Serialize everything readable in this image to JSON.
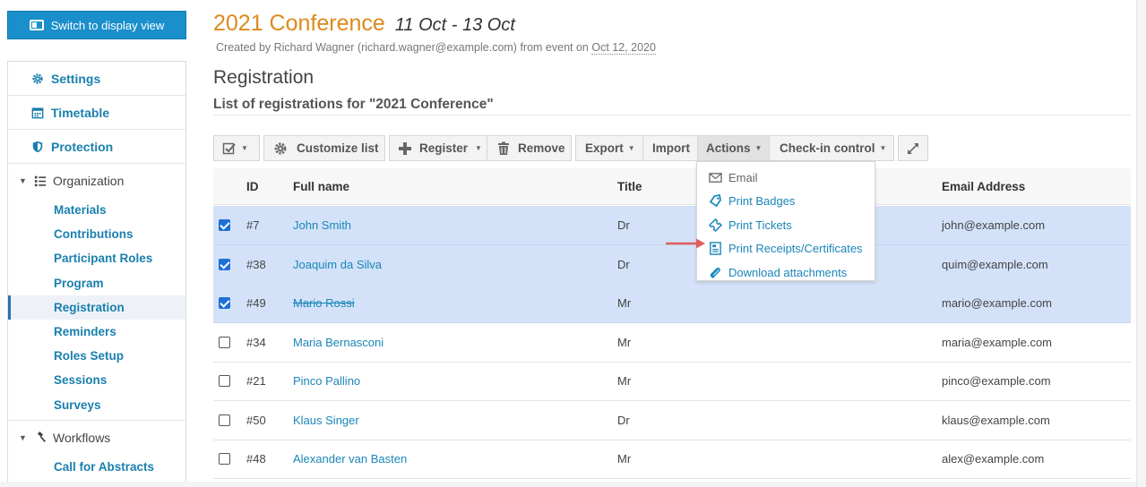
{
  "sidebar": {
    "switch_label": "Switch to display view",
    "items": [
      {
        "label": "Settings"
      },
      {
        "label": "Timetable"
      },
      {
        "label": "Protection"
      }
    ],
    "organization": {
      "label": "Organization",
      "children": [
        "Materials",
        "Contributions",
        "Participant Roles",
        "Program",
        "Registration",
        "Reminders",
        "Roles Setup",
        "Sessions",
        "Surveys"
      ]
    },
    "workflows": {
      "label": "Workflows",
      "children": [
        "Call for Abstracts"
      ]
    }
  },
  "header": {
    "title": "2021 Conference",
    "dates": "11 Oct - 13 Oct",
    "created_prefix": "Created by Richard Wagner (richard.wagner@example.com) from event on ",
    "created_date": "Oct 12, 2020",
    "section": "Registration",
    "subtitle": "List of registrations for \"2021 Conference\""
  },
  "toolbar": {
    "customize": "Customize list",
    "register": "Register",
    "remove": "Remove",
    "export": "Export",
    "import": "Import",
    "actions": "Actions",
    "checkin": "Check-in control"
  },
  "actions_menu": {
    "email": "Email",
    "print_badges": "Print Badges",
    "print_tickets": "Print Tickets",
    "print_receipts": "Print Receipts/Certificates",
    "download": "Download attachments"
  },
  "table": {
    "headers": {
      "id": "ID",
      "name": "Full name",
      "title": "Title",
      "email": "Email Address"
    },
    "rows": [
      {
        "id": "#7",
        "name": "John Smith",
        "title": "Dr",
        "email": "john@example.com",
        "selected": true
      },
      {
        "id": "#38",
        "name": "Joaquim da Silva",
        "title": "Dr",
        "email": "quim@example.com",
        "selected": true
      },
      {
        "id": "#49",
        "name": "Mario Rossi",
        "title": "Mr",
        "email": "mario@example.com",
        "selected": true
      },
      {
        "id": "#34",
        "name": "Maria Bernasconi",
        "title": "Mr",
        "email": "maria@example.com",
        "selected": false
      },
      {
        "id": "#21",
        "name": "Pinco Pallino",
        "title": "Mr",
        "email": "pinco@example.com",
        "selected": false
      },
      {
        "id": "#50",
        "name": "Klaus Singer",
        "title": "Dr",
        "email": "klaus@example.com",
        "selected": false
      },
      {
        "id": "#48",
        "name": "Alexander van Basten",
        "title": "Mr",
        "email": "alex@example.com",
        "selected": false
      }
    ]
  },
  "colors": {
    "accent": "#1a86b8",
    "title": "#dd8a1c",
    "selected_row": "#d3e2f8",
    "arrow": "#e05c5c"
  }
}
